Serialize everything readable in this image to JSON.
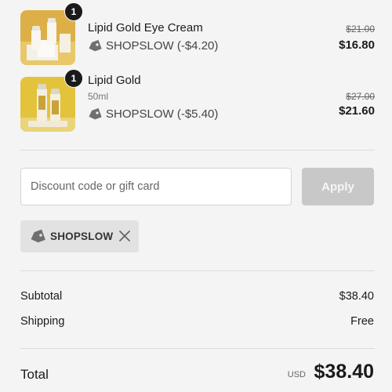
{
  "line_items": [
    {
      "quantity": "1",
      "title": "Lipid Gold Eye Cream",
      "variant": "",
      "discount": "SHOPSLOW (-$4.20)",
      "original_price": "$21.00",
      "price": "$16.80",
      "thumbnail": "lipid-gold-eye-cream-product-image"
    },
    {
      "quantity": "1",
      "title": "Lipid Gold",
      "variant": "50ml",
      "discount": "SHOPSLOW (-$5.40)",
      "original_price": "$27.00",
      "price": "$21.60",
      "thumbnail": "lipid-gold-product-image"
    }
  ],
  "discount_form": {
    "placeholder": "Discount code or gift card",
    "value": "",
    "apply_label": "Apply"
  },
  "applied_code": {
    "code": "SHOPSLOW",
    "icon": "tag-icon",
    "remove_icon": "close-icon"
  },
  "summary": {
    "subtotal_label": "Subtotal",
    "subtotal_value": "$38.40",
    "shipping_label": "Shipping",
    "shipping_value": "Free"
  },
  "total": {
    "label": "Total",
    "currency": "USD",
    "value": "$38.40"
  },
  "colors": {
    "background": "#f4f4f4",
    "thumbnail_gold": "#e0b431",
    "apply_disabled": "#c8c8c8",
    "chip_background": "#e2e2e2"
  }
}
